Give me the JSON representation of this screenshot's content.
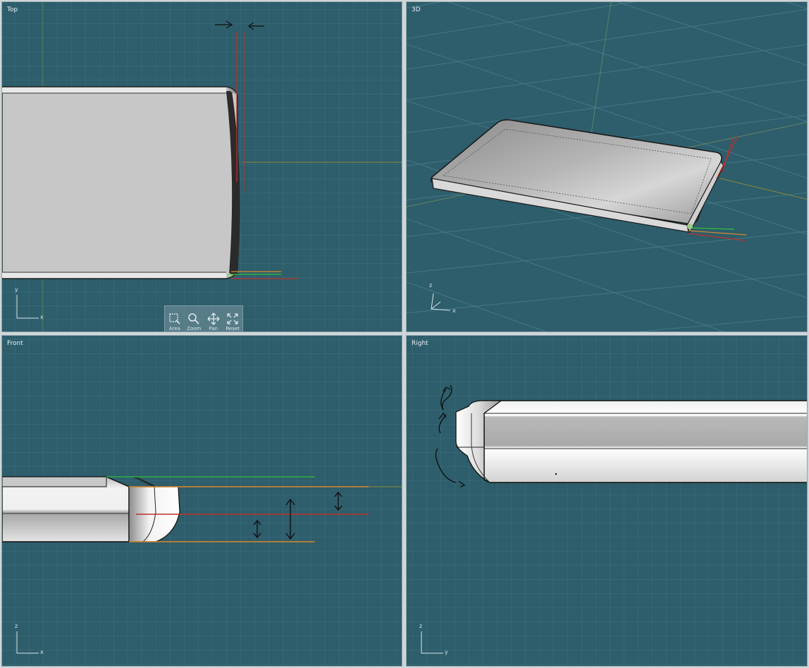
{
  "viewports": {
    "top": {
      "title": "Top",
      "axis_vertical": "y",
      "axis_horizontal": "x"
    },
    "persp": {
      "title": "3D",
      "axis_vertical": "z",
      "axis_horizontal": "x"
    },
    "front": {
      "title": "Front",
      "axis_vertical": "z",
      "axis_horizontal": "x"
    },
    "right": {
      "title": "Right",
      "axis_vertical": "z",
      "axis_horizontal": "y"
    }
  },
  "nav_controls": [
    {
      "label": "Area",
      "icon": "area-zoom-icon"
    },
    {
      "label": "Zoom",
      "icon": "magnifier-icon"
    },
    {
      "label": "Pan",
      "icon": "pan-arrows-icon"
    },
    {
      "label": "Reset",
      "icon": "reset-expand-icon"
    }
  ],
  "colors": {
    "viewport_bg": "#2e5d6b",
    "grid_minor": "#3d6f7d",
    "grid_major": "#4b8190",
    "red_guide": "#c0302a",
    "green_guide": "#2fc23a",
    "orange_guide": "#d98a2a",
    "panel_border": "#8fa4ab"
  }
}
